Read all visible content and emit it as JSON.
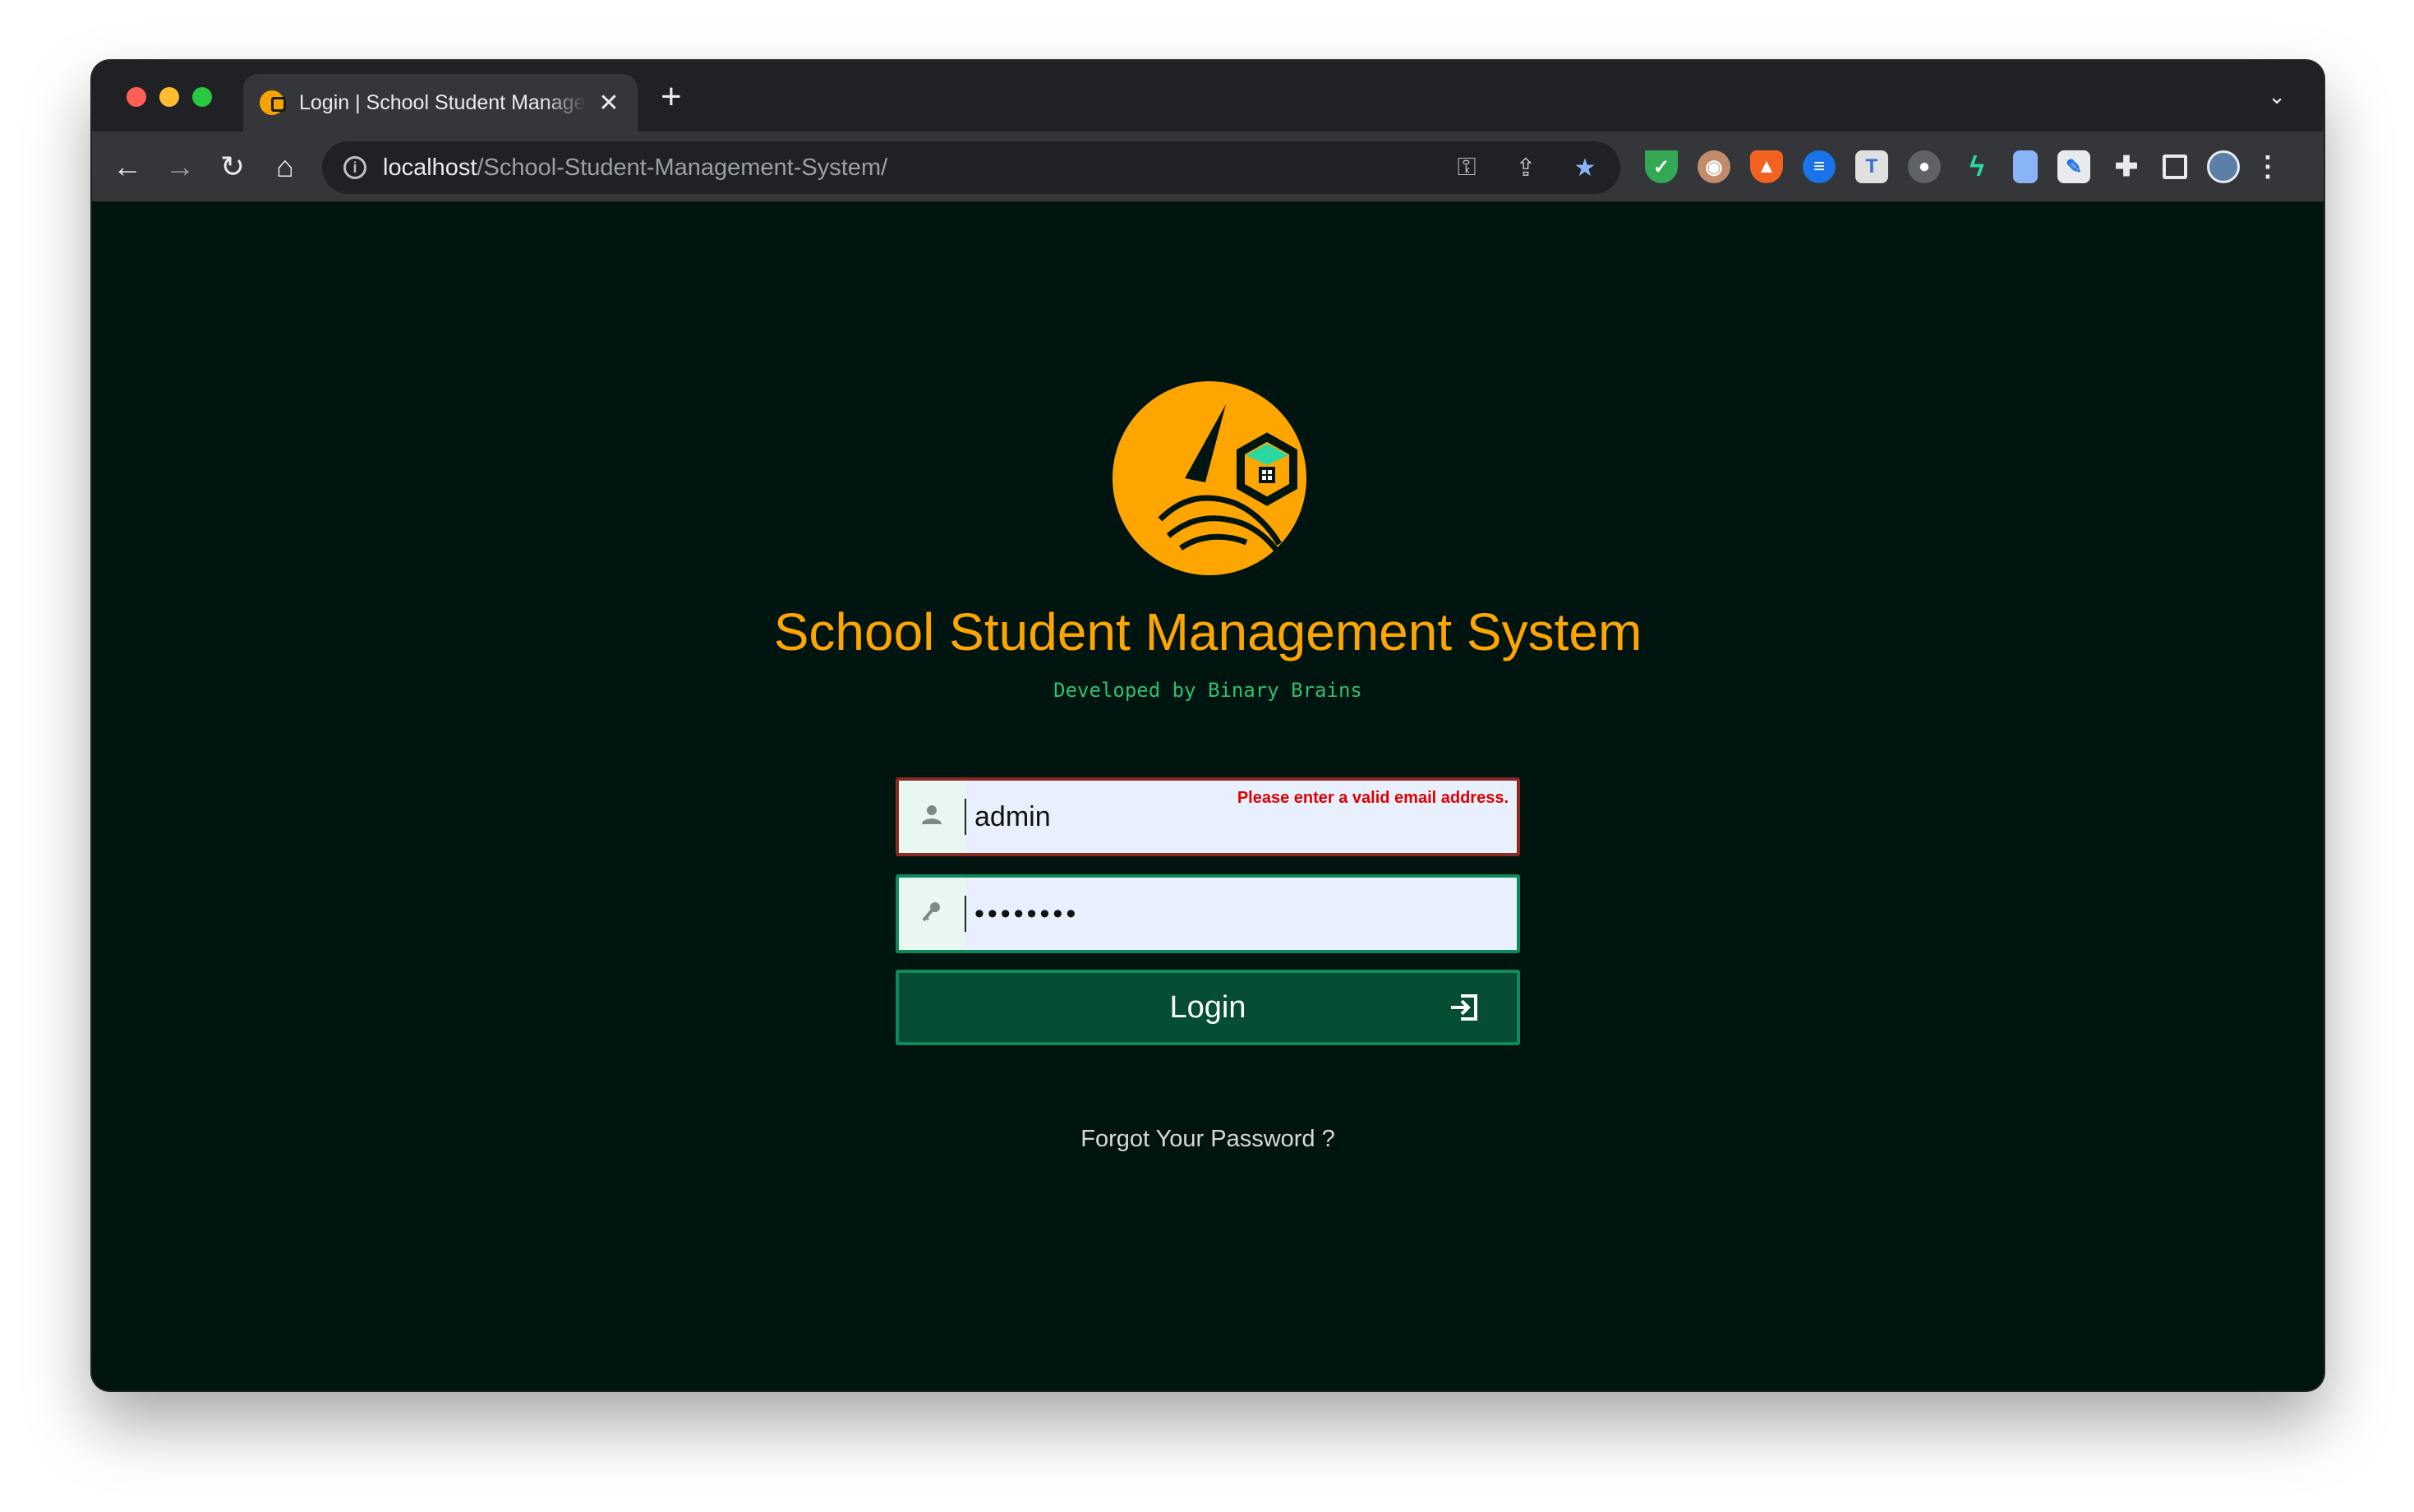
{
  "browser": {
    "tab_title": "Login | School Student Management System",
    "tab_close": "✕",
    "new_tab": "+",
    "tab_menu": "⌄",
    "url_host": "localhost",
    "url_path": "/School-Student-Management-System/",
    "info_glyph": "i",
    "nav": {
      "back": "←",
      "forward": "→",
      "reload": "↻",
      "home": "⌂"
    },
    "omni_icons": {
      "key": "⚿",
      "share": "⇪",
      "star": "★"
    },
    "extensions": [
      {
        "name": "shield-extension-icon",
        "glyph": "✓"
      },
      {
        "name": "glasses-extension-icon",
        "glyph": "◉"
      },
      {
        "name": "fox-extension-icon",
        "glyph": "▲"
      },
      {
        "name": "doc-extension-icon",
        "glyph": "≡"
      },
      {
        "name": "t-extension-icon",
        "glyph": "T"
      },
      {
        "name": "camera-extension-icon",
        "glyph": "●"
      },
      {
        "name": "bolt-extension-icon",
        "glyph": "ϟ"
      },
      {
        "name": "book-extension-icon",
        "glyph": ""
      },
      {
        "name": "image-edit-extension-icon",
        "glyph": "✎"
      },
      {
        "name": "puzzle-extensions-icon",
        "glyph": "✚"
      },
      {
        "name": "side-panel-icon",
        "glyph": ""
      },
      {
        "name": "profile-avatar-icon",
        "glyph": ""
      },
      {
        "name": "chrome-menu-icon",
        "glyph": "⋮"
      }
    ]
  },
  "page": {
    "title": "School Student Management System",
    "subtitle": "Developed by Binary Brains",
    "username": {
      "value": "admin",
      "error": "Please enter a valid email address.",
      "icon": "👤"
    },
    "password": {
      "value": "••••••••",
      "icon": "🔑"
    },
    "login_label": "Login",
    "forgot_label": "Forgot Your Password ?"
  },
  "colors": {
    "page_bg": "#001510",
    "title": "#ffa500",
    "subtitle": "#2fbf71",
    "button_bg": "#054d33",
    "error": "#e00000"
  }
}
